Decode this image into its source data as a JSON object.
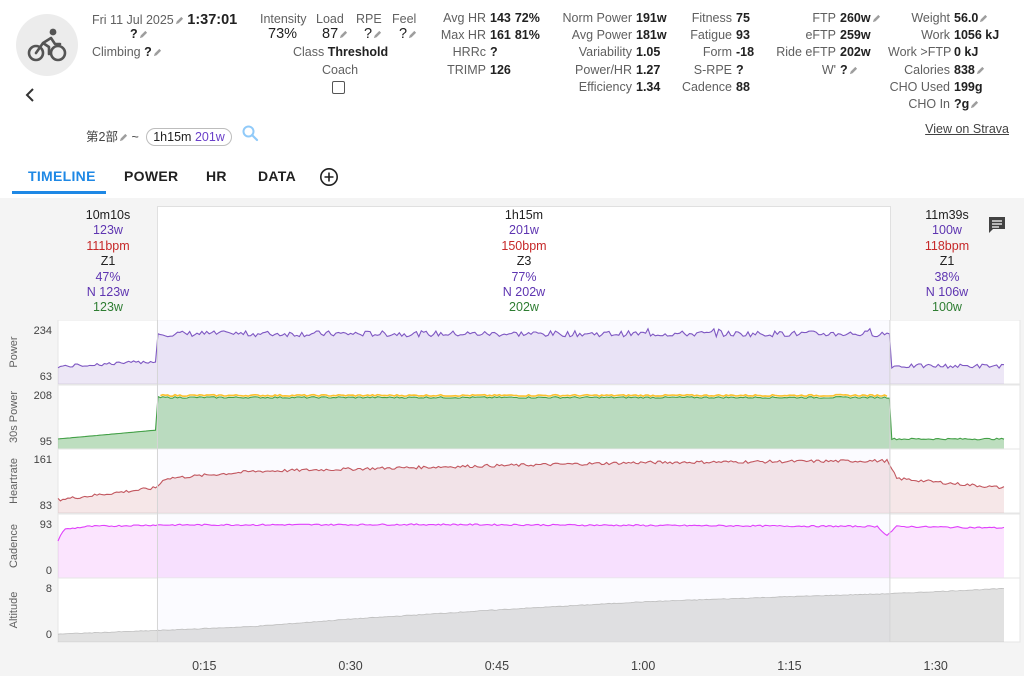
{
  "header": {
    "date": "Fri 11 Jul 2025",
    "duration": "1:37:01",
    "title_placeholder": "?",
    "climbing_label": "Climbing",
    "climbing_value": "?",
    "intensity_label": "Intensity",
    "intensity_value": "73%",
    "load_label": "Load",
    "load_value": "87",
    "rpe_label": "RPE",
    "rpe_value": "?",
    "feel_label": "Feel",
    "feel_value": "?",
    "class_label": "Class",
    "class_value": "Threshold",
    "coach_label": "Coach"
  },
  "stats_col1": [
    {
      "label": "Avg HR",
      "value": "143",
      "extra": "72%"
    },
    {
      "label": "Max HR",
      "value": "161",
      "extra": "81%"
    },
    {
      "label": "HRRc",
      "value": "?",
      "extra": ""
    },
    {
      "label": "TRIMP",
      "value": "126",
      "extra": ""
    }
  ],
  "stats_col2": [
    {
      "label": "Norm Power",
      "value": "191w"
    },
    {
      "label": "Avg Power",
      "value": "181w"
    },
    {
      "label": "Variability",
      "value": "1.05"
    },
    {
      "label": "Power/HR",
      "value": "1.27"
    },
    {
      "label": "Efficiency",
      "value": "1.34"
    }
  ],
  "stats_col3": [
    {
      "label": "Fitness",
      "value": "75"
    },
    {
      "label": "Fatigue",
      "value": "93"
    },
    {
      "label": "Form",
      "value": "-18"
    },
    {
      "label": "S-RPE",
      "value": "?"
    },
    {
      "label": "Cadence",
      "value": "88"
    }
  ],
  "stats_col4": [
    {
      "label": "FTP",
      "value": "260w"
    },
    {
      "label": "eFTP",
      "value": "259w"
    },
    {
      "label": "Ride eFTP",
      "value": "202w"
    },
    {
      "label": "W'",
      "value": "?"
    }
  ],
  "stats_col5": [
    {
      "label": "Weight",
      "value": "56.0"
    },
    {
      "label": "Work",
      "value": "1056 kJ"
    },
    {
      "label": "Work >FTP",
      "value": "0 kJ"
    },
    {
      "label": "Calories",
      "value": "838"
    },
    {
      "label": "CHO Used",
      "value": "199g"
    },
    {
      "label": "CHO In",
      "value": "?g"
    }
  ],
  "strava_link": "View on Strava",
  "segment": {
    "name": "第2部",
    "sep": "~",
    "duration": "1h15m",
    "power": "201w"
  },
  "tabs": [
    "TIMELINE",
    "POWER",
    "HR",
    "DATA"
  ],
  "laps": [
    {
      "time": "10m10s",
      "power": "123w",
      "hr": "111bpm",
      "zone": "Z1",
      "pct": "47%",
      "np": "N 123w",
      "p30": "123w"
    },
    {
      "time": "1h15m",
      "power": "201w",
      "hr": "150bpm",
      "zone": "Z3",
      "pct": "77%",
      "np": "N 202w",
      "p30": "202w"
    },
    {
      "time": "11m39s",
      "power": "100w",
      "hr": "118bpm",
      "zone": "Z1",
      "pct": "38%",
      "np": "N 106w",
      "p30": "100w"
    }
  ],
  "chart_data": {
    "type": "line",
    "x_ticks": [
      "0:15",
      "0:30",
      "0:45",
      "1:00",
      "1:15",
      "1:30"
    ],
    "x_tick_minutes": [
      15,
      30,
      45,
      60,
      75,
      90
    ],
    "x_range_minutes": [
      0,
      97
    ],
    "panels": [
      {
        "name": "Power",
        "ticks": [
          "234",
          "63"
        ],
        "ylim": [
          63,
          234
        ],
        "color": "#7e57c2",
        "segments": [
          {
            "from": 0,
            "to": 10.2,
            "level": 113
          },
          {
            "from": 10.2,
            "to": 85.3,
            "level": 220
          },
          {
            "from": 85.3,
            "to": 97,
            "level": 100
          }
        ]
      },
      {
        "name": "30s Power",
        "ticks": [
          "208",
          "95"
        ],
        "ylim": [
          95,
          208
        ],
        "color": "#43a047",
        "cap_color": "#fbc02d",
        "segments": [
          {
            "from": 0,
            "to": 10.2,
            "level": 120
          },
          {
            "from": 10.2,
            "to": 85.3,
            "level": 202
          },
          {
            "from": 85.3,
            "to": 97,
            "level": 100
          }
        ]
      },
      {
        "name": "Heartrate",
        "ticks": [
          "161",
          "83"
        ],
        "ylim": [
          83,
          161
        ],
        "color": "#c2575f",
        "points": [
          [
            0,
            92
          ],
          [
            4,
            100
          ],
          [
            10,
            112
          ],
          [
            11,
            128
          ],
          [
            20,
            140
          ],
          [
            40,
            148
          ],
          [
            60,
            155
          ],
          [
            85,
            158
          ],
          [
            86,
            128
          ],
          [
            90,
            122
          ],
          [
            97,
            112
          ]
        ]
      },
      {
        "name": "Cadence",
        "ticks": [
          "93",
          "0"
        ],
        "ylim": [
          0,
          93
        ],
        "color": "#e040fb",
        "points": [
          [
            0,
            60
          ],
          [
            0.6,
            82
          ],
          [
            3,
            88
          ],
          [
            10,
            91
          ],
          [
            40,
            92
          ],
          [
            84,
            88
          ],
          [
            85,
            70
          ],
          [
            86,
            88
          ],
          [
            97,
            85
          ]
        ]
      },
      {
        "name": "Altitude",
        "ticks": [
          "8",
          "0"
        ],
        "ylim": [
          0,
          8
        ],
        "color": "#bdbdbd",
        "points": [
          [
            0,
            0
          ],
          [
            10,
            0.6
          ],
          [
            20,
            1.3
          ],
          [
            30,
            2.6
          ],
          [
            45,
            4.2
          ],
          [
            60,
            5.6
          ],
          [
            75,
            6.5
          ],
          [
            85,
            7.0
          ],
          [
            97,
            7.9
          ]
        ]
      }
    ]
  }
}
